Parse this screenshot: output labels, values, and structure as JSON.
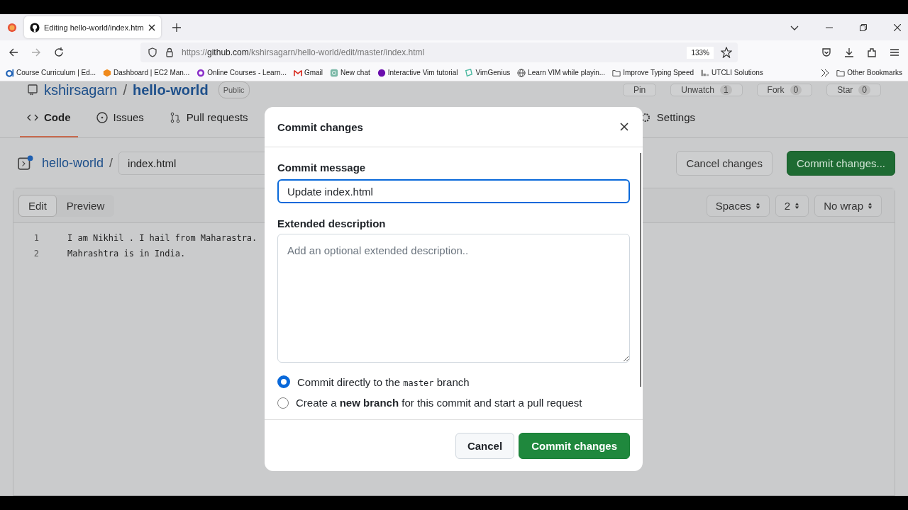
{
  "browser": {
    "tab_title": "Editing hello-world/index.htm",
    "url_prefix": "https://",
    "url_host": "github.com",
    "url_path": "/kshirsagarn/hello-world/edit/master/index.html",
    "zoom": "133%",
    "bookmarks": [
      {
        "label": "Course Curriculum | Ed..."
      },
      {
        "label": "Dashboard | EC2 Man..."
      },
      {
        "label": "Online Courses - Learn..."
      },
      {
        "label": "Gmail"
      },
      {
        "label": "New chat"
      },
      {
        "label": "Interactive Vim tutorial"
      },
      {
        "label": "VimGenius"
      },
      {
        "label": "Learn VIM while playin..."
      },
      {
        "label": "Improve Typing Speed"
      },
      {
        "label": "UTCLI Solutions"
      }
    ],
    "other_bookmarks": "Other Bookmarks"
  },
  "repo": {
    "owner": "kshirsagarn",
    "separator": "/",
    "name": "hello-world",
    "visibility": "Public",
    "actions": [
      {
        "label": "Pin"
      },
      {
        "label": "Unwatch",
        "count": "1"
      },
      {
        "label": "Fork",
        "count": "0"
      },
      {
        "label": "Star",
        "count": "0"
      }
    ],
    "nav": [
      {
        "label": "Code",
        "selected": true
      },
      {
        "label": "Issues",
        "selected": false
      },
      {
        "label": "Pull requests",
        "selected": false
      },
      {
        "label": "Settings",
        "selected": false
      }
    ]
  },
  "editor": {
    "repo_link": "hello-world",
    "separator": "/",
    "file_name": "index.html",
    "cancel_button": "Cancel changes",
    "commit_button": "Commit changes...",
    "tabs": [
      {
        "label": "Edit",
        "selected": true
      },
      {
        "label": "Preview",
        "selected": false
      }
    ],
    "selects": [
      "Spaces",
      "2",
      "No wrap"
    ],
    "lines": [
      {
        "number": "1",
        "text": "I am Nikhil . I hail from Maharastra."
      },
      {
        "number": "2",
        "text": "Mahrashtra is in India."
      }
    ]
  },
  "dialog": {
    "title": "Commit changes",
    "message_label": "Commit message",
    "message_value": "Update index.html",
    "description_label": "Extended description",
    "description_placeholder": "Add an optional extended description..",
    "options": [
      {
        "kind": "branch",
        "before": "Commit directly to the",
        "code": "master",
        "after": "branch",
        "selected": true
      },
      {
        "kind": "plain",
        "text": "Create a **new branch** for this commit and start a pull request",
        "selected": false
      }
    ],
    "cancel": "Cancel",
    "submit": "Commit changes"
  }
}
